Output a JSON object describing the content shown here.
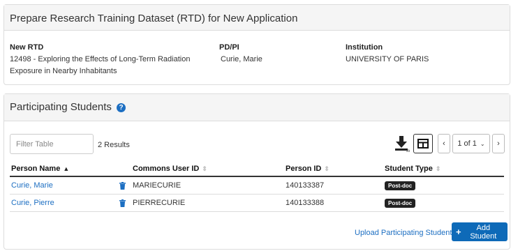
{
  "rtd_card": {
    "title": "Prepare Research Training Dataset (RTD) for New Application",
    "new_rtd_label": "New RTD",
    "new_rtd_value": "12498 - Exploring the Effects of Long-Term Radiation Exposure in Nearby Inhabitants",
    "pdpi_label": "PD/PI",
    "pdpi_value": "Curie, Marie",
    "institution_label": "Institution",
    "institution_value": "UNIVERSITY OF PARIS"
  },
  "students_card": {
    "title": "Participating Students",
    "help_icon": "?",
    "filter_placeholder": "Filter Table",
    "results_text": "2 Results",
    "pagination_text": "1 of 1",
    "columns": [
      "Person Name",
      "Commons User ID",
      "Person ID",
      "Student Type"
    ],
    "rows": [
      {
        "name": "Curie, Marie",
        "commons_id": "MARIECURIE",
        "person_id": "140133387",
        "type": "Post-doc"
      },
      {
        "name": "Curie, Pierre",
        "commons_id": "PIERRECURIE",
        "person_id": "140133388",
        "type": "Post-doc"
      }
    ],
    "upload_link": "Upload Participating Students",
    "add_button": "Add Student"
  },
  "icons": {
    "download": "download-icon",
    "columns": "column-toggle-icon",
    "prev": "chevron-left-icon",
    "next": "chevron-right-icon",
    "trash": "trash-icon",
    "plus": "plus-icon"
  },
  "colors": {
    "link": "#1d6fc2",
    "primary_button": "#0e6ab8",
    "badge": "#222222",
    "header_bg": "#f5f5f5"
  }
}
